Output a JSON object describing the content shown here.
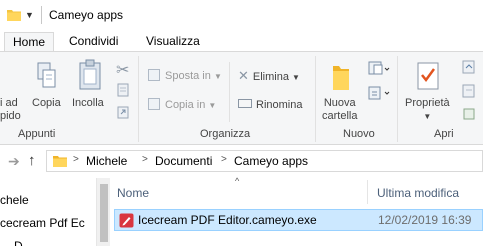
{
  "window": {
    "title": "Cameyo apps"
  },
  "tabs": [
    {
      "label": "Home"
    },
    {
      "label": "Condividi"
    },
    {
      "label": "Visualizza"
    }
  ],
  "ribbon": {
    "clipboard": {
      "pin_label_line1": "i ad",
      "pin_label_line2": "pido",
      "copy_label": "Copia",
      "paste_label": "Incolla",
      "group_label": "Appunti"
    },
    "organize": {
      "move_to_label": "Sposta in",
      "copy_to_label": "Copia in",
      "delete_label": "Elimina",
      "rename_label": "Rinomina",
      "group_label": "Organizza"
    },
    "new": {
      "new_folder_line1": "Nuova",
      "new_folder_line2": "cartella",
      "group_label": "Nuovo"
    },
    "open": {
      "properties_label": "Proprietà",
      "group_label": "Apri"
    }
  },
  "address": {
    "crumbs": [
      "Michele",
      "Documenti",
      "Cameyo apps"
    ]
  },
  "navpane": {
    "items": [
      "chele",
      "cecream Pdf Ec",
      "D"
    ]
  },
  "filelist": {
    "columns": {
      "name": "Nome",
      "modified": "Ultima modifica"
    },
    "rows": [
      {
        "name": "Icecream PDF Editor.cameyo.exe",
        "modified": "12/02/2019 16:39"
      }
    ]
  },
  "colors": {
    "selection": "#cce8ff",
    "selection_border": "#99d1ff",
    "ribbon_bg": "#f5f6f7",
    "folder": "#f4c542",
    "properties_check": "#e2541f"
  }
}
